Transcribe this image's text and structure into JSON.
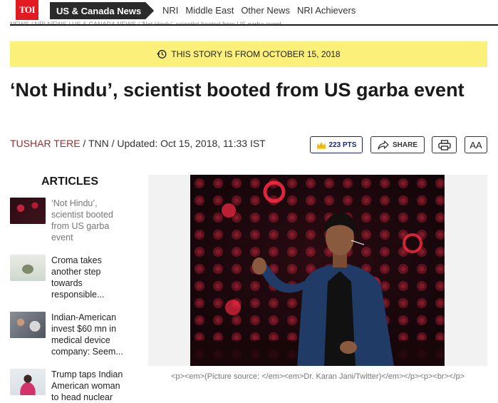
{
  "nav": {
    "logo": "TOI",
    "section": "US & Canada News",
    "links": [
      "NRI",
      "Middle East",
      "Other News",
      "NRI Achievers"
    ],
    "breadcrumb": "NEWS / NRI NEWS / US & CANADA NEWS / 'Not Hindu', scientist booted from US garba event"
  },
  "banner": {
    "text": "THIS STORY IS FROM OCTOBER 15, 2018"
  },
  "headline": "‘Not Hindu’, scientist booted from US garba event",
  "byline": {
    "author": "TUSHAR TERE",
    "rest": " / TNN / Updated: Oct 15, 2018, 11:33 IST"
  },
  "actions": {
    "points": "223 PTS",
    "share": "SHARE",
    "font_size": "AA"
  },
  "sidebar": {
    "title": "ARTICLES",
    "items": [
      {
        "text": "‘Not Hindu’, scientist booted from US garba event"
      },
      {
        "text": "Croma takes another step towards responsible..."
      },
      {
        "text": "Indian-American invest $60 mn in medical device company: Seem..."
      },
      {
        "text": "Trump taps Indian American woman to head nuclear"
      }
    ]
  },
  "caption": "<p><em>(Picture source: </em><em>Dr. Karan Jani/Twitter)</em></p><p><br></p>",
  "colors": {
    "logo_red": "#e21b22",
    "banner_yellow": "#fbf07a",
    "author_red": "#9b2c2c",
    "points_blue": "#1a237e"
  }
}
